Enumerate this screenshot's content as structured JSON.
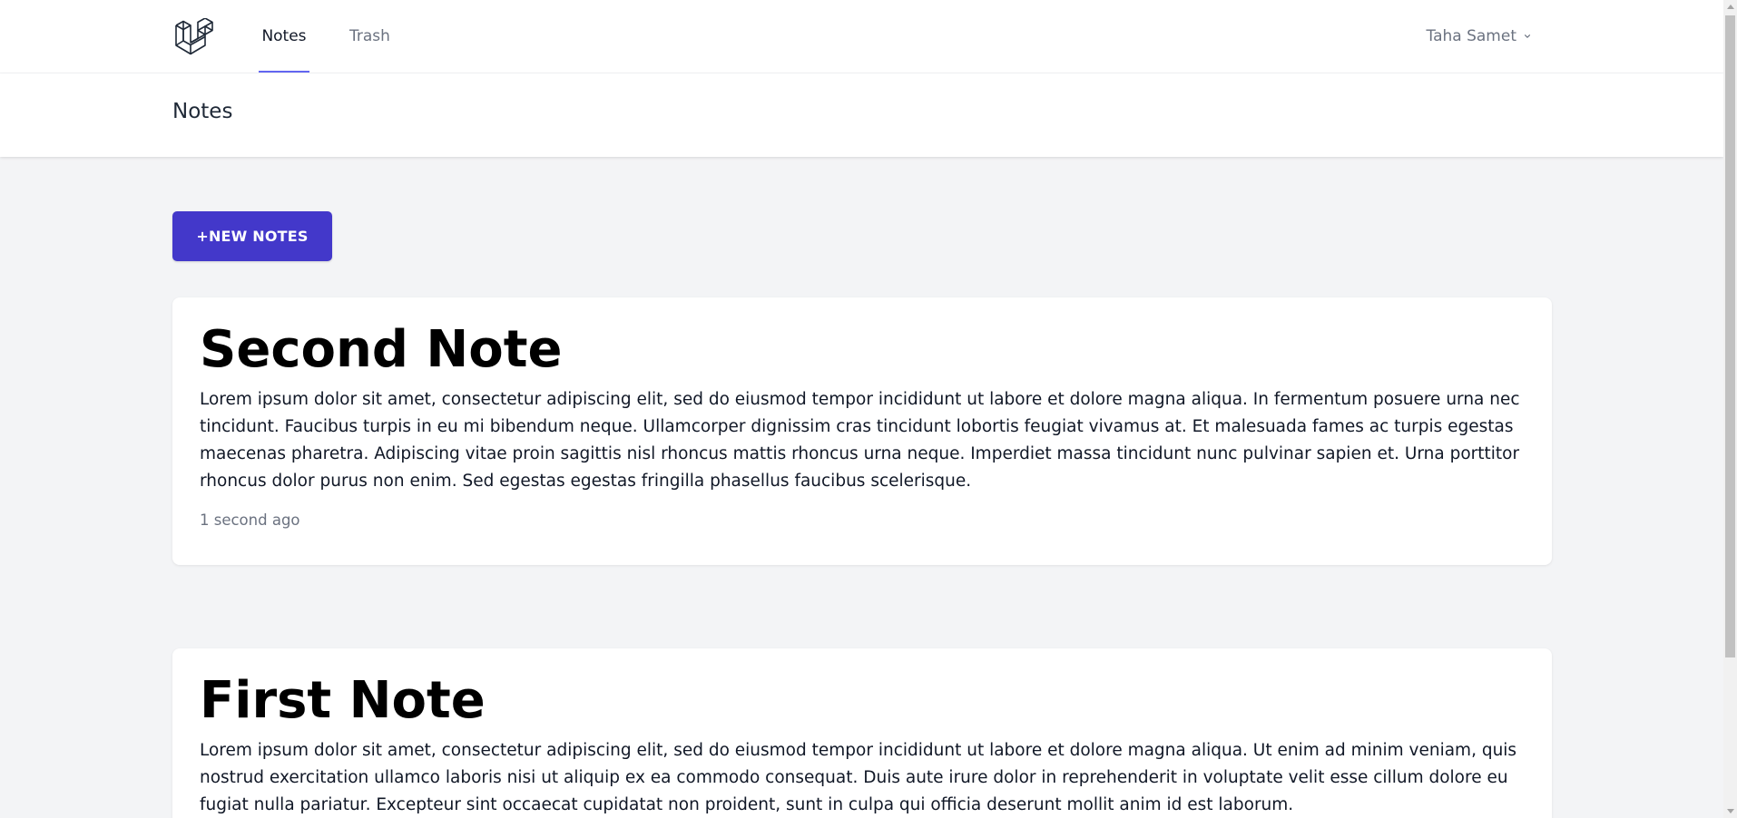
{
  "nav": {
    "logo_icon": "laravel-logo-icon",
    "links": [
      {
        "label": "Notes",
        "active": true
      },
      {
        "label": "Trash",
        "active": false
      }
    ],
    "user": {
      "name": "Taha Samet",
      "icon": "chevron-down-icon"
    }
  },
  "header": {
    "title": "Notes"
  },
  "main": {
    "new_button_label": "+NEW NOTES",
    "notes": [
      {
        "title": "Second Note",
        "body": "Lorem ipsum dolor sit amet, consectetur adipiscing elit, sed do eiusmod tempor incididunt ut labore et dolore magna aliqua. In fermentum posuere urna nec tincidunt. Faucibus turpis in eu mi bibendum neque. Ullamcorper dignissim cras tincidunt lobortis feugiat vivamus at. Et malesuada fames ac turpis egestas maecenas pharetra. Adipiscing vitae proin sagittis nisl rhoncus mattis rhoncus urna neque. Imperdiet massa tincidunt nunc pulvinar sapien et. Urna porttitor rhoncus dolor purus non enim. Sed egestas egestas fringilla phasellus faucibus scelerisque.",
        "time": "1 second ago"
      },
      {
        "title": "First Note",
        "body": "Lorem ipsum dolor sit amet, consectetur adipiscing elit, sed do eiusmod tempor incididunt ut labore et dolore magna aliqua. Ut enim ad minim veniam, quis nostrud exercitation ullamco laboris nisi ut aliquip ex ea commodo consequat. Duis aute irure dolor in reprehenderit in voluptate velit esse cillum dolore eu fugiat nulla pariatur. Excepteur sint occaecat cupidatat non proident, sunt in culpa qui officia deserunt mollit anim id est laborum."
      }
    ]
  },
  "colors": {
    "accent": "#4338ca",
    "active_tab_underline": "#6366f1",
    "page_background": "#f3f4f6"
  }
}
